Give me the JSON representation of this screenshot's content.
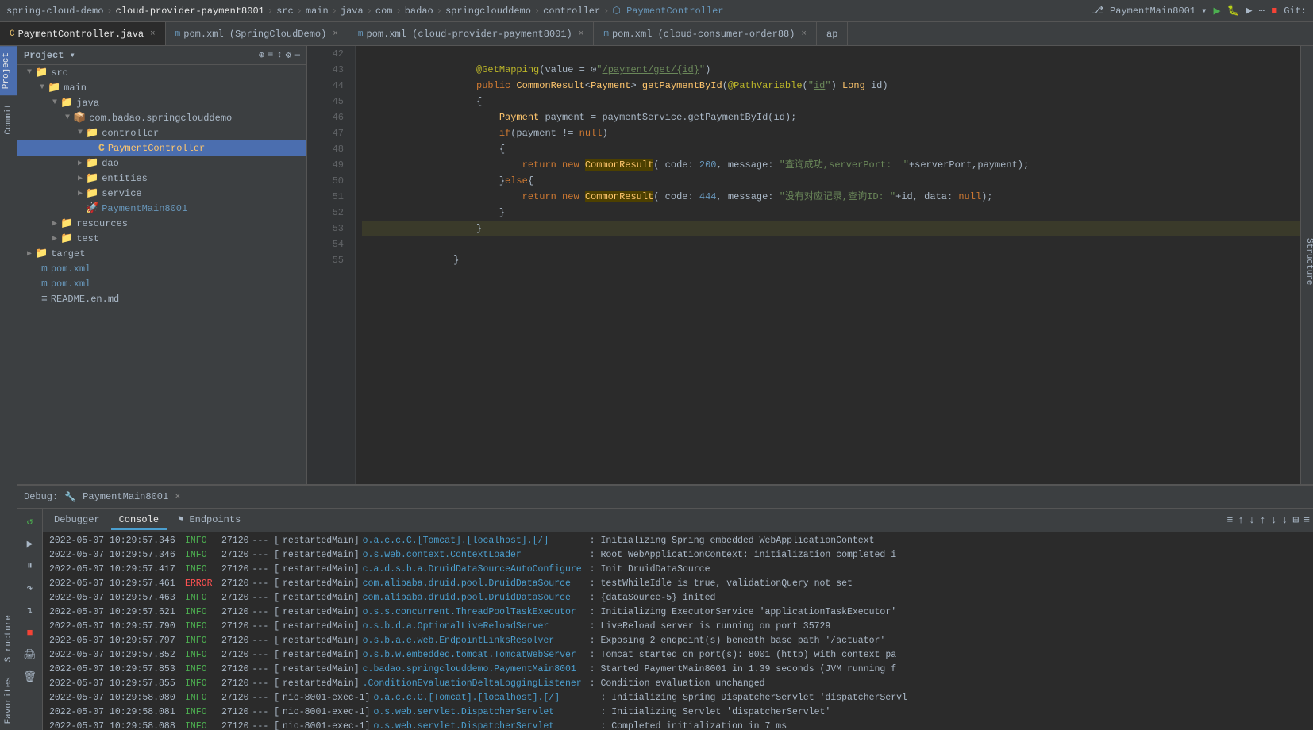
{
  "breadcrumb": {
    "items": [
      "spring-cloud-demo",
      "cloud-provider-payment8001",
      "src",
      "main",
      "java",
      "com",
      "badao",
      "springclouddemo",
      "controller",
      "PaymentController"
    ]
  },
  "tabs": [
    {
      "id": "payment-controller",
      "label": "PaymentController.java",
      "icon": "C",
      "icon_color": "#e8bf6a",
      "active": true,
      "closable": true
    },
    {
      "id": "pom-spring",
      "label": "pom.xml (SpringCloudDemo)",
      "icon": "m",
      "icon_color": "#6897bb",
      "active": false,
      "closable": true
    },
    {
      "id": "pom-payment",
      "label": "pom.xml (cloud-provider-payment8001)",
      "icon": "m",
      "icon_color": "#6897bb",
      "active": false,
      "closable": true
    },
    {
      "id": "pom-consumer",
      "label": "pom.xml (cloud-consumer-order88)",
      "icon": "m",
      "icon_color": "#6897bb",
      "active": false,
      "closable": true
    },
    {
      "id": "ap",
      "label": "ap",
      "icon": "",
      "active": false,
      "closable": false
    }
  ],
  "sidebar": {
    "title": "Project",
    "tree": [
      {
        "id": "src",
        "label": "src",
        "type": "folder",
        "level": 1,
        "expanded": true
      },
      {
        "id": "main",
        "label": "main",
        "type": "folder",
        "level": 2,
        "expanded": true
      },
      {
        "id": "java",
        "label": "java",
        "type": "folder",
        "level": 3,
        "expanded": true
      },
      {
        "id": "com.badao",
        "label": "com.badao.springclouddemo",
        "type": "package",
        "level": 4,
        "expanded": true
      },
      {
        "id": "controller",
        "label": "controller",
        "type": "folder",
        "level": 5,
        "expanded": true
      },
      {
        "id": "PaymentController",
        "label": "PaymentController",
        "type": "controller",
        "level": 6,
        "expanded": false,
        "selected": true
      },
      {
        "id": "dao",
        "label": "dao",
        "type": "folder",
        "level": 5,
        "expanded": false
      },
      {
        "id": "entities",
        "label": "entities",
        "type": "folder",
        "level": 5,
        "expanded": false
      },
      {
        "id": "service",
        "label": "service",
        "type": "folder",
        "level": 5,
        "expanded": false
      },
      {
        "id": "PaymentMain8001",
        "label": "PaymentMain8001",
        "type": "main",
        "level": 5,
        "expanded": false
      },
      {
        "id": "resources",
        "label": "resources",
        "type": "folder",
        "level": 3,
        "expanded": false
      },
      {
        "id": "test",
        "label": "test",
        "type": "folder",
        "level": 3,
        "expanded": false
      },
      {
        "id": "target",
        "label": "target",
        "type": "folder-yellow",
        "level": 1,
        "expanded": false
      },
      {
        "id": "pom-file",
        "label": "pom.xml",
        "type": "xml",
        "level": 1
      },
      {
        "id": "pom-file2",
        "label": "pom.xml",
        "type": "xml",
        "level": 1
      },
      {
        "id": "readme",
        "label": "README.en.md",
        "type": "md",
        "level": 1
      }
    ]
  },
  "code": {
    "lines": [
      {
        "num": 42,
        "content": "    @GetMapping(value = \"/payment/get/{id}\")",
        "highlight": false
      },
      {
        "num": 43,
        "content": "    public CommonResult<Payment> getPaymentById(@PathVariable(\"id\") Long id)",
        "highlight": false
      },
      {
        "num": 44,
        "content": "    {",
        "highlight": false
      },
      {
        "num": 45,
        "content": "        Payment payment = paymentService.getPaymentById(id);",
        "highlight": false
      },
      {
        "num": 46,
        "content": "        if(payment != null)",
        "highlight": false
      },
      {
        "num": 47,
        "content": "        {",
        "highlight": false
      },
      {
        "num": 48,
        "content": "            return new CommonResult( code: 200, message: \"查询成功,serverPort:  \"+serverPort,payment);",
        "highlight": false
      },
      {
        "num": 49,
        "content": "        }else{",
        "highlight": false
      },
      {
        "num": 50,
        "content": "            return new CommonResult( code: 444, message: \"没有对应记录,查询ID: \"+id, data: null);",
        "highlight": false
      },
      {
        "num": 51,
        "content": "        }",
        "highlight": false
      },
      {
        "num": 52,
        "content": "    }",
        "highlight": false
      },
      {
        "num": 53,
        "content": "",
        "highlight": true
      },
      {
        "num": 54,
        "content": "}",
        "highlight": false
      },
      {
        "num": 55,
        "content": "",
        "highlight": false
      }
    ]
  },
  "debug_bar": {
    "label": "Debug:",
    "session": "PaymentMain8001",
    "close_label": "×"
  },
  "debug_tabs": {
    "tabs": [
      "Debugger",
      "Console",
      "Endpoints"
    ],
    "active": "Console",
    "toolbar_icons": [
      "≡",
      "↑",
      "↓",
      "↓",
      "↑",
      "↓",
      "⊞",
      "≡"
    ]
  },
  "console_logs": [
    {
      "ts": "2022-05-07 10:29:57.346",
      "level": "INFO",
      "pid": "27120",
      "sep": "---",
      "thread": "restartedMain",
      "logger": "o.a.c.c.C.[Tomcat].[localhost].[/]",
      "msg": ": Initializing Spring embedded WebApplicationContext"
    },
    {
      "ts": "2022-05-07 10:29:57.346",
      "level": "INFO",
      "pid": "27120",
      "sep": "---",
      "thread": "restartedMain",
      "logger": "o.s.web.context.ContextLoader",
      "msg": ": Root WebApplicationContext: initialization completed i"
    },
    {
      "ts": "2022-05-07 10:29:57.417",
      "level": "INFO",
      "pid": "27120",
      "sep": "---",
      "thread": "restartedMain",
      "logger": "c.a.d.s.b.a.DruidDataSourceAutoConfigure",
      "msg": ": Init DruidDataSource"
    },
    {
      "ts": "2022-05-07 10:29:57.461",
      "level": "ERROR",
      "pid": "27120",
      "sep": "---",
      "thread": "restartedMain",
      "logger": "com.alibaba.druid.pool.DruidDataSource",
      "msg": ": testWhileIdle is true, validationQuery not set"
    },
    {
      "ts": "2022-05-07 10:29:57.463",
      "level": "INFO",
      "pid": "27120",
      "sep": "---",
      "thread": "restartedMain",
      "logger": "com.alibaba.druid.pool.DruidDataSource",
      "msg": ": {dataSource-5} inited"
    },
    {
      "ts": "2022-05-07 10:29:57.621",
      "level": "INFO",
      "pid": "27120",
      "sep": "---",
      "thread": "restartedMain",
      "logger": "o.s.s.concurrent.ThreadPoolTaskExecutor",
      "msg": ": Initializing ExecutorService 'applicationTaskExecutor'"
    },
    {
      "ts": "2022-05-07 10:29:57.790",
      "level": "INFO",
      "pid": "27120",
      "sep": "---",
      "thread": "restartedMain",
      "logger": "o.s.b.d.a.OptionalLiveReloadServer",
      "msg": ": LiveReload server is running on port 35729"
    },
    {
      "ts": "2022-05-07 10:29:57.797",
      "level": "INFO",
      "pid": "27120",
      "sep": "---",
      "thread": "restartedMain",
      "logger": "o.s.b.a.e.web.EndpointLinksResolver",
      "msg": ": Exposing 2 endpoint(s) beneath base path '/actuator'"
    },
    {
      "ts": "2022-05-07 10:29:57.852",
      "level": "INFO",
      "pid": "27120",
      "sep": "---",
      "thread": "restartedMain",
      "logger": "o.s.b.w.embedded.tomcat.TomcatWebServer",
      "msg": ": Tomcat started on port(s): 8001 (http) with context pa"
    },
    {
      "ts": "2022-05-07 10:29:57.853",
      "level": "INFO",
      "pid": "27120",
      "sep": "---",
      "thread": "restartedMain",
      "logger": "c.badao.springclouddemo.PaymentMain8001",
      "msg": ": Started PaymentMain8001 in 1.39 seconds (JVM running f"
    },
    {
      "ts": "2022-05-07 10:29:57.855",
      "level": "INFO",
      "pid": "27120",
      "sep": "---",
      "thread": "restartedMain",
      "logger": ".ConditionEvaluationDeltaLoggingListener",
      "msg": ": Condition evaluation unchanged"
    },
    {
      "ts": "2022-05-07 10:29:58.080",
      "level": "INFO",
      "pid": "27120",
      "sep": "---",
      "thread": "nio-8001-exec-1",
      "logger": "o.a.c.c.C.[Tomcat].[localhost].[/]",
      "msg": ": Initializing Spring DispatcherServlet 'dispatcherServl"
    },
    {
      "ts": "2022-05-07 10:29:58.081",
      "level": "INFO",
      "pid": "27120",
      "sep": "---",
      "thread": "nio-8001-exec-1",
      "logger": "o.s.web.servlet.DispatcherServlet",
      "msg": ": Initializing Servlet 'dispatcherServlet'"
    },
    {
      "ts": "2022-05-07 10:29:58.088",
      "level": "INFO",
      "pid": "27120",
      "sep": "---",
      "thread": "nio-8001-exec-1",
      "logger": "o.s.web.servlet.DispatcherServlet",
      "msg": ": Completed initialization in 7 ms"
    }
  ],
  "far_left": {
    "labels": [
      "Project",
      "Commit",
      "Structure",
      "Favorites"
    ]
  },
  "structure_panel": "Structure"
}
